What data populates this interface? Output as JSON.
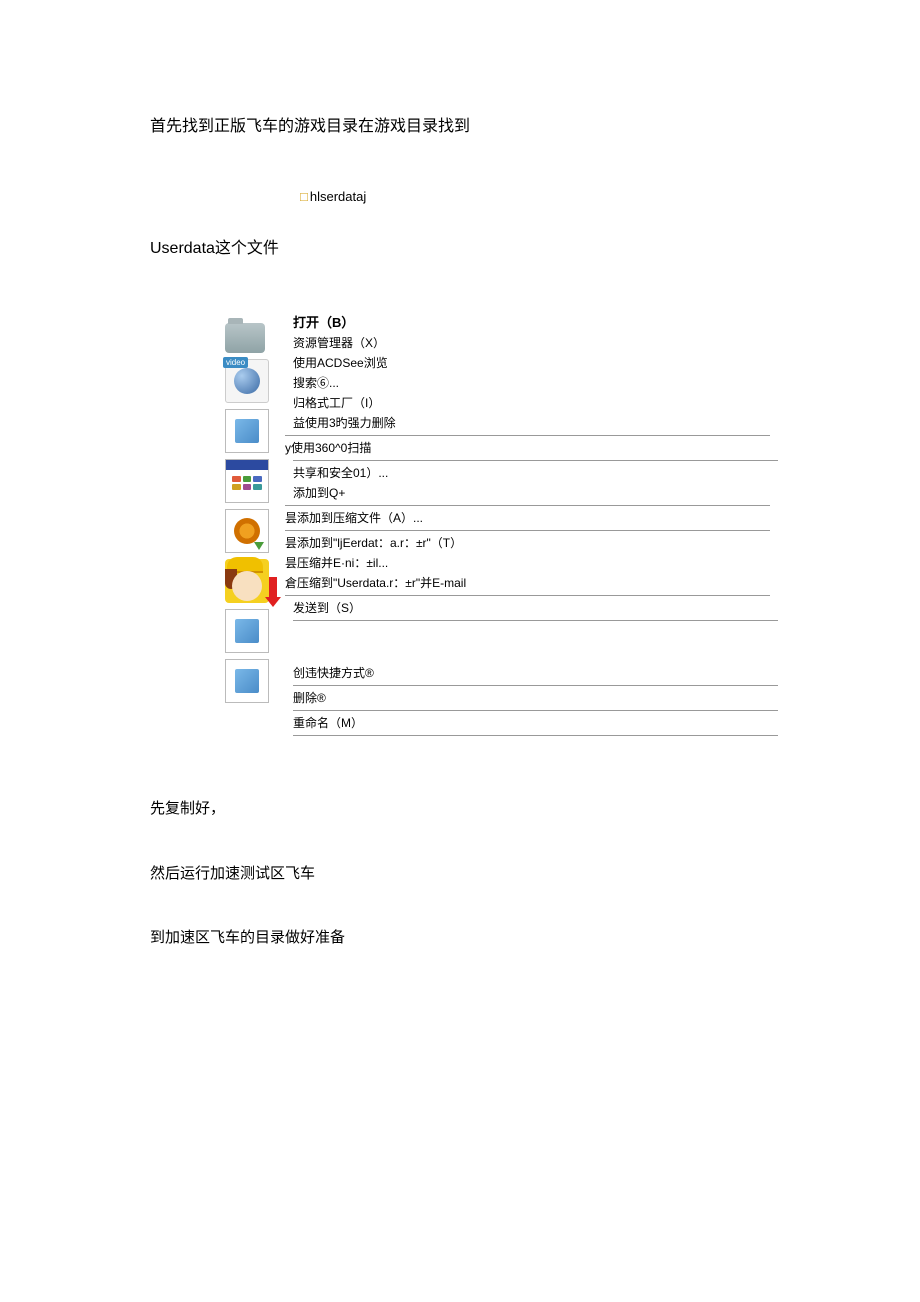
{
  "paragraphs": {
    "p1": "首先找到正版飞车的游戏目录在游戏目录找到",
    "folder_label": "hlserdataj",
    "userdata_prefix": "Userdata",
    "userdata_suffix": "这个文件",
    "p2": "先复制好，",
    "p3": "然后运行加速测试区飞车",
    "p4": "到加速区飞车的目录做好准备"
  },
  "menu": {
    "open": "打开（B）",
    "explorer": "资源管理器（X）",
    "acdsee": "使用ACDSee浏览",
    "search": "搜索⑥...",
    "format": "归格式工厂（I）",
    "delete360": "益使用3旳强力删除",
    "scan360": "y使用360^0扫描",
    "share": "共享和安全01）...",
    "qplus": "添加到Q+",
    "archive_a": "昙添加到压缩文件（A）...",
    "archive_t": "昙添加到\"ljEerdat：a.r：±r\"（T）",
    "compress_eni": "昙压缩并E·ni：±il...",
    "compress_email": "倉压缩到\"Userdata.r：±r\"并E-mail",
    "sendto": "发送到（S）",
    "shortcut": "创违快捷方式®",
    "delete": "删除®",
    "rename": "重命名（M）"
  },
  "video_tag": "video"
}
